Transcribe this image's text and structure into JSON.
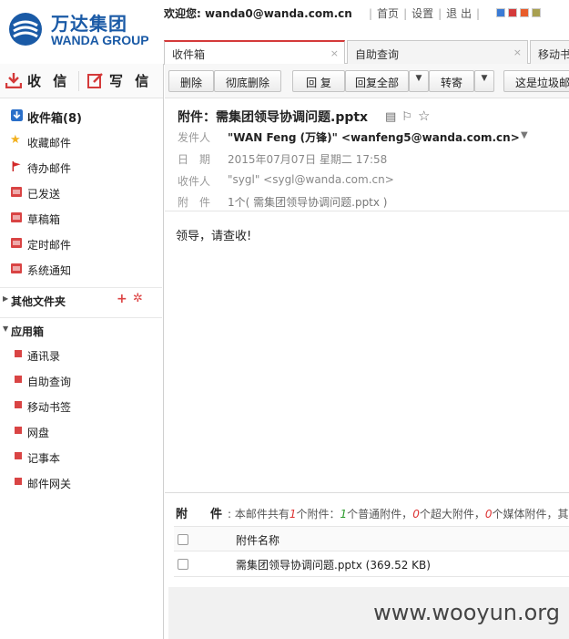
{
  "header": {
    "brand_cn": "万达集团",
    "brand_en": "WANDA GROUP",
    "welcome": "欢迎您: wanda0@wanda.com.cn",
    "links": [
      "首页",
      "设置",
      "退 出"
    ],
    "skin_colors": [
      "#3a7bd5",
      "#d43a3a",
      "#e85c2a",
      "#a8a050"
    ]
  },
  "tabs": [
    {
      "label": "收件箱",
      "close": "×"
    },
    {
      "label": "自助查询",
      "close": "×"
    },
    {
      "label": "移动书"
    }
  ],
  "compose": {
    "receive": "收 信",
    "write": "写 信"
  },
  "folders": [
    {
      "label": "收件箱(8)",
      "icon": "inbox-icon"
    },
    {
      "label": "收藏邮件",
      "icon": "star-icon"
    },
    {
      "label": "待办邮件",
      "icon": "flag-icon"
    },
    {
      "label": "已发送",
      "icon": "folder-icon"
    },
    {
      "label": "草稿箱",
      "icon": "folder-icon"
    },
    {
      "label": "定时邮件",
      "icon": "folder-icon"
    },
    {
      "label": "系统通知",
      "icon": "folder-icon"
    }
  ],
  "other_folders": {
    "label": "其他文件夹",
    "add": "+",
    "settings": "✲"
  },
  "apps": {
    "label": "应用箱",
    "items": [
      "通讯录",
      "自助查询",
      "移动书签",
      "网盘",
      "记事本",
      "邮件网关"
    ]
  },
  "toolbar": {
    "delete": "删除",
    "delete_forever": "彻底删除",
    "reply": "回 复",
    "reply_all": "回复全部",
    "forward": "转寄",
    "dropdown": "▼",
    "spam": "这是垃圾邮"
  },
  "mail": {
    "subject": "附件：需集团领导协调问题.pptx",
    "from_label": "发件人",
    "from_value": "\"WAN Feng (万锋)\" <wanfeng5@wanda.com.cn>",
    "from_caret": "▼",
    "date_label": "日　期",
    "date_value": "2015年07月07日 星期二 17:58",
    "to_label": "收件人",
    "to_value": "\"sygl\" <sygl@wanda.com.cn>",
    "attach_label": "附　件",
    "attach_inline": "1个( 需集团领导协调问题.pptx )",
    "body": "领导，请查收!"
  },
  "attachments": {
    "title": "附　件",
    "summary_1": ": 本邮件共有",
    "total": "1",
    "summary_2": "个附件：",
    "normal": "1",
    "summary_3": "个普通附件，",
    "large": "0",
    "summary_4": "个超大附件，",
    "media": "0",
    "summary_5": "个媒体附件，其中",
    "col_name": "附件名称",
    "files": [
      {
        "name": "需集团领导协调问题.pptx (369.52 KB)"
      }
    ]
  },
  "watermark": "www.wooyun.org"
}
